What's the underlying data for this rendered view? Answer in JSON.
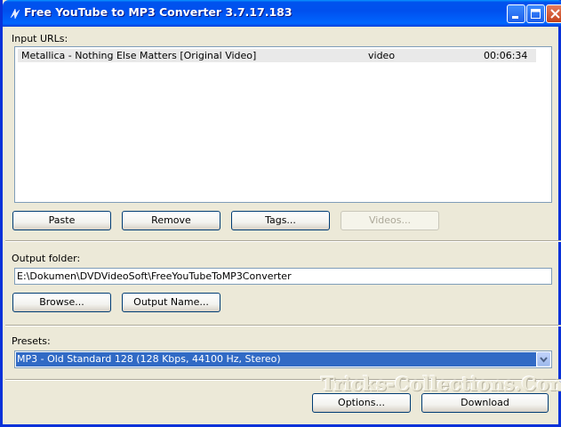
{
  "window": {
    "title": "Free YouTube to MP3 Converter 3.7.17.183"
  },
  "input_urls": {
    "label": "Input URLs:",
    "rows": [
      {
        "title": "Metallica - Nothing Else Matters [Original  Video]",
        "type": "video",
        "duration": "00:06:34"
      }
    ]
  },
  "buttons": {
    "paste": "Paste",
    "remove": "Remove",
    "tags": "Tags...",
    "videos": "Videos...",
    "browse": "Browse...",
    "output_name": "Output Name...",
    "options": "Options...",
    "download": "Download"
  },
  "output_folder": {
    "label": "Output folder:",
    "value": "E:\\Dokumen\\DVDVideoSoft\\FreeYouTubeToMP3Converter"
  },
  "presets": {
    "label": "Presets:",
    "selected": "MP3 - Old Standard 128 (128 Kbps, 44100 Hz, Stereo)"
  },
  "watermark": "Tricks-Collections.Com"
}
